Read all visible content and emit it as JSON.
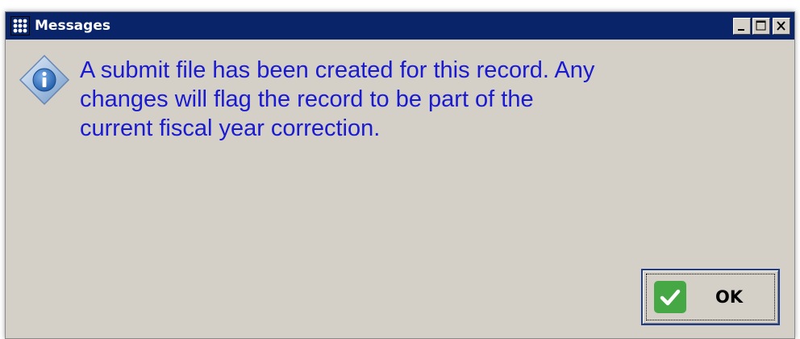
{
  "window": {
    "title": "Messages",
    "titlebar_color": "#0a246a",
    "background_color": "#d4d0c8",
    "controls": {
      "minimize_icon": "minimize-icon",
      "maximize_icon": "maximize-icon",
      "close_icon": "close-icon"
    }
  },
  "message": {
    "icon": "info-icon",
    "text": "A submit file has been created for this record. Any changes will flag the record to be part of the current fiscal year correction.",
    "text_color": "#1a1ad0"
  },
  "ok_button": {
    "label": "OK",
    "icon": "checkmark-icon",
    "icon_color": "#45a845"
  }
}
